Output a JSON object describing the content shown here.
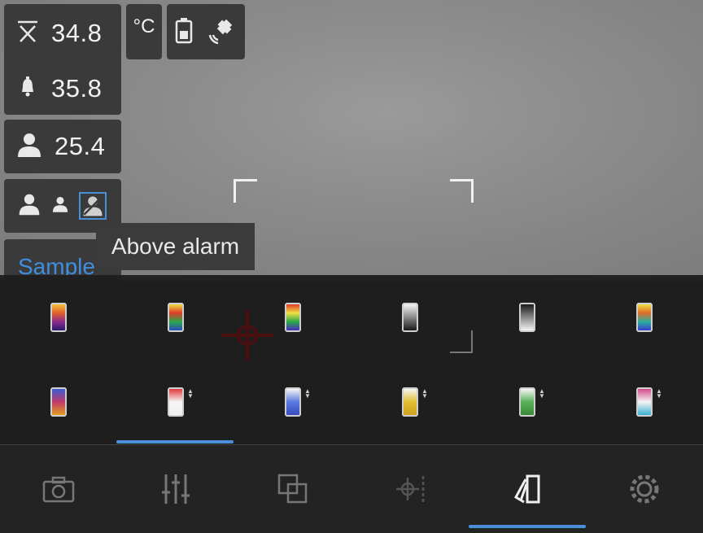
{
  "readings": {
    "max_value": "34.8",
    "alarm_value": "35.8",
    "person_value": "25.4",
    "unit": "°C"
  },
  "icons": {
    "max": "max-temperature-icon",
    "alarm": "bell-icon",
    "person": "person-icon",
    "battery": "battery-icon",
    "satellite": "satellite-icon"
  },
  "tooltip": {
    "text": "Above alarm"
  },
  "sample_label": "Sample",
  "palettes": {
    "row1": [
      {
        "name": "palette-iron",
        "colors": [
          "#f3c13a",
          "#e0602a",
          "#8b2a8c",
          "#2a1a6b"
        ]
      },
      {
        "name": "palette-rainbow",
        "colors": [
          "#f0e040",
          "#e03a2a",
          "#2aa84a",
          "#2a4ac0"
        ]
      },
      {
        "name": "palette-rainbow-hc",
        "colors": [
          "#e03a2a",
          "#f0e040",
          "#2aa84a",
          "#4a2ac0"
        ]
      },
      {
        "name": "palette-white-hot",
        "colors": [
          "#f5f5f5",
          "#888888",
          "#1a1a1a"
        ]
      },
      {
        "name": "palette-black-hot",
        "colors": [
          "#1a1a1a",
          "#888888",
          "#f5f5f5"
        ]
      },
      {
        "name": "palette-lava",
        "colors": [
          "#f0e040",
          "#e06a2a",
          "#2ab0a0",
          "#3a3ad0"
        ]
      }
    ],
    "row2": [
      {
        "name": "palette-arctic",
        "colors": [
          "#3a5ad0",
          "#c03a6a",
          "#e0a020"
        ],
        "arrows": false
      },
      {
        "name": "palette-above-red",
        "colors": [
          "#e03a3a",
          "#f5f5f5",
          "#f0f0f0"
        ],
        "arrows": true
      },
      {
        "name": "palette-above-blue",
        "colors": [
          "#f5f5f5",
          "#5a7ae0",
          "#3a4ac0"
        ],
        "arrows": true
      },
      {
        "name": "palette-above-yellow",
        "colors": [
          "#f5f5f5",
          "#e0c030",
          "#d0a020"
        ],
        "arrows": true
      },
      {
        "name": "palette-above-green",
        "colors": [
          "#f5f5f5",
          "#5ab05a",
          "#3a8a3a"
        ],
        "arrows": true
      },
      {
        "name": "palette-above-pink",
        "colors": [
          "#d04a8a",
          "#f5f5f5",
          "#3ab0d0"
        ],
        "arrows": true
      }
    ]
  },
  "toolbar": [
    "camera-icon",
    "sliders-icon",
    "overlay-icon",
    "target-icon",
    "palette-cards-icon",
    "gear-icon"
  ],
  "colors": {
    "accent": "#4a90d9",
    "sample_text": "#3f8fe0"
  }
}
